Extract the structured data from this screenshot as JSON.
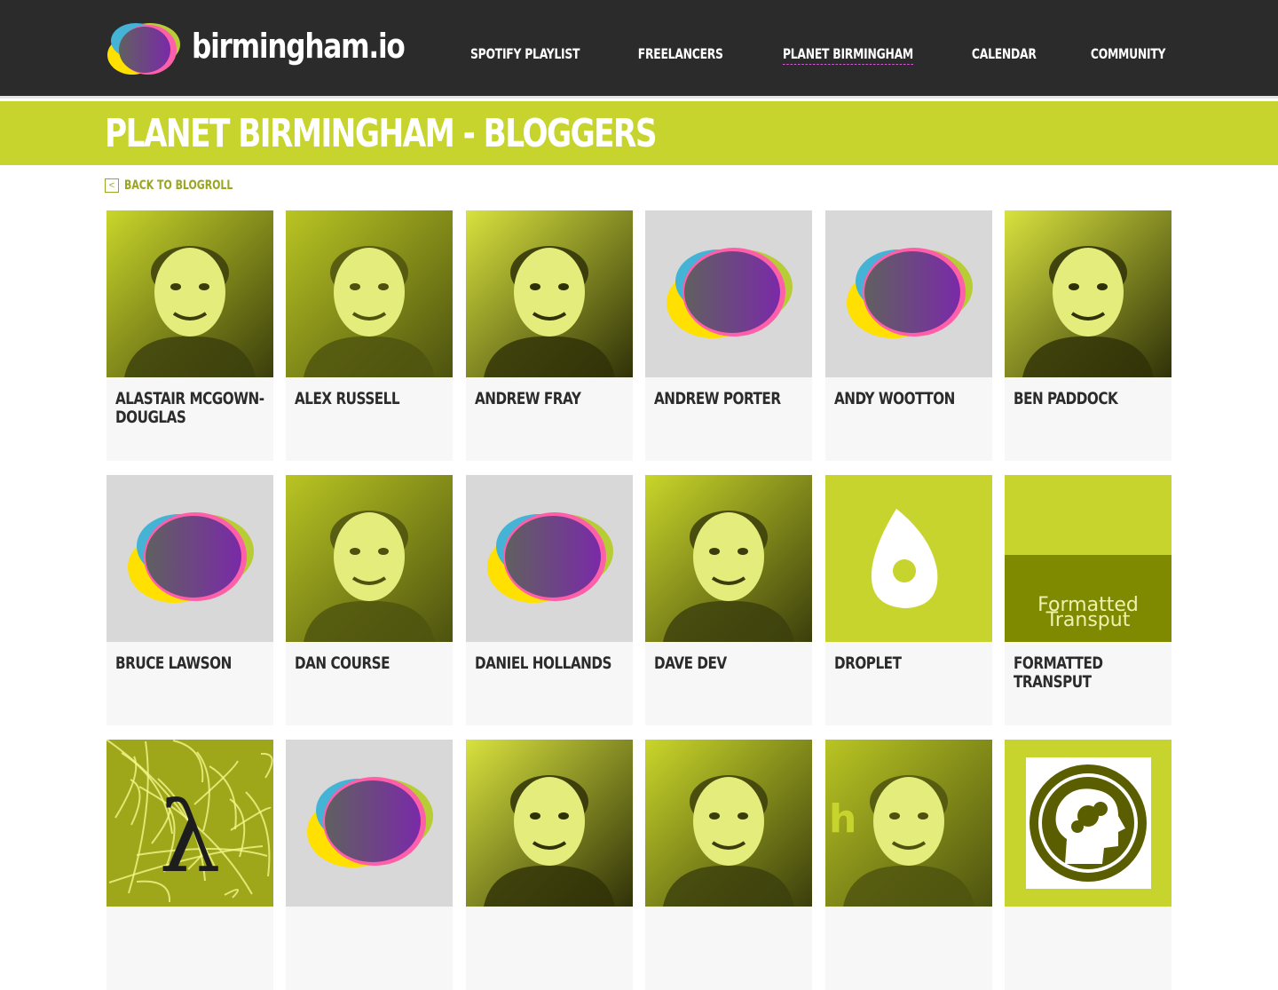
{
  "site": {
    "brand": "birmingham.io"
  },
  "nav": [
    "SPOTIFY PLAYLIST",
    "FREELANCERS",
    "PLANET BIRMINGHAM",
    "CALENDAR",
    "COMMUNITY"
  ],
  "nav_active": "PLANET BIRMINGHAM",
  "page": {
    "title": "PLANET BIRMINGHAM - BLOGGERS",
    "back_label": "BACK TO BLOGROLL"
  },
  "bloggers": [
    {
      "name": "ALASTAIR MCGOWN-DOUGLAS",
      "avatar": "photo"
    },
    {
      "name": "ALEX RUSSELL",
      "avatar": "photo"
    },
    {
      "name": "ANDREW FRAY",
      "avatar": "photo"
    },
    {
      "name": "ANDREW PORTER",
      "avatar": "default-logo"
    },
    {
      "name": "ANDY WOOTTON",
      "avatar": "default-logo"
    },
    {
      "name": "BEN PADDOCK",
      "avatar": "photo"
    },
    {
      "name": "BRUCE LAWSON",
      "avatar": "default-logo"
    },
    {
      "name": "DAN COURSE",
      "avatar": "photo"
    },
    {
      "name": "DANIEL HOLLANDS",
      "avatar": "default-logo"
    },
    {
      "name": "DAVE DEV",
      "avatar": "photo"
    },
    {
      "name": "DROPLET",
      "avatar": "droplet-logo"
    },
    {
      "name": "FORMATTED TRANSPUT",
      "avatar": "formatted-transput-logo",
      "logo_text": [
        "Formatted",
        "Transput"
      ]
    },
    {
      "name": "",
      "avatar": "lambda-logo",
      "logo_text": [
        "λ"
      ]
    },
    {
      "name": "",
      "avatar": "default-logo"
    },
    {
      "name": "",
      "avatar": "photo"
    },
    {
      "name": "",
      "avatar": "photo"
    },
    {
      "name": "",
      "avatar": "photo-h",
      "logo_text": [
        "h"
      ]
    },
    {
      "name": "",
      "avatar": "brain-logo"
    }
  ],
  "colors": {
    "header_bg": "#2b2b2b",
    "accent_lime": "#c8d42e",
    "tint": "#d6e02a",
    "text_dark": "#2b2b2b"
  }
}
